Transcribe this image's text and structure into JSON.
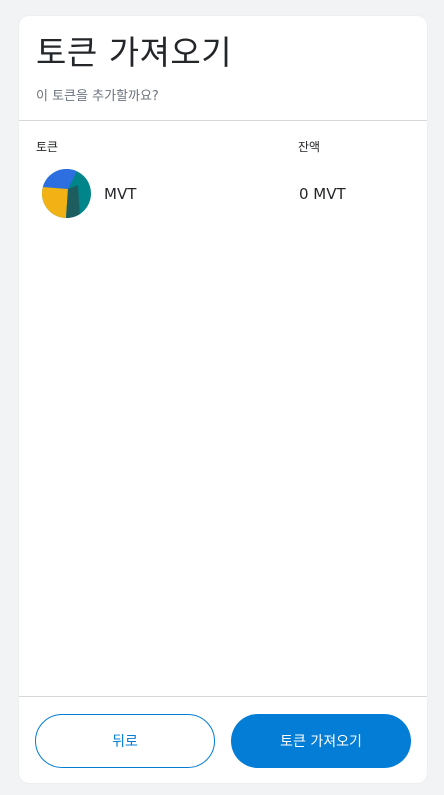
{
  "header": {
    "title": "토큰 가져오기",
    "subtitle": "이 토큰을 추가할까요?"
  },
  "table": {
    "columns": [
      "토큰",
      "잔액"
    ],
    "rows": [
      {
        "symbol": "MVT",
        "balance": "0 MVT",
        "icon": "mvt-token-icon"
      }
    ]
  },
  "footer": {
    "back_label": "뒤로",
    "import_label": "토큰 가져오기"
  },
  "colors": {
    "primary": "#037dd6",
    "background": "#f2f3f4",
    "text": "#24272a",
    "muted": "#6a737d",
    "divider": "#d6d9dc"
  }
}
